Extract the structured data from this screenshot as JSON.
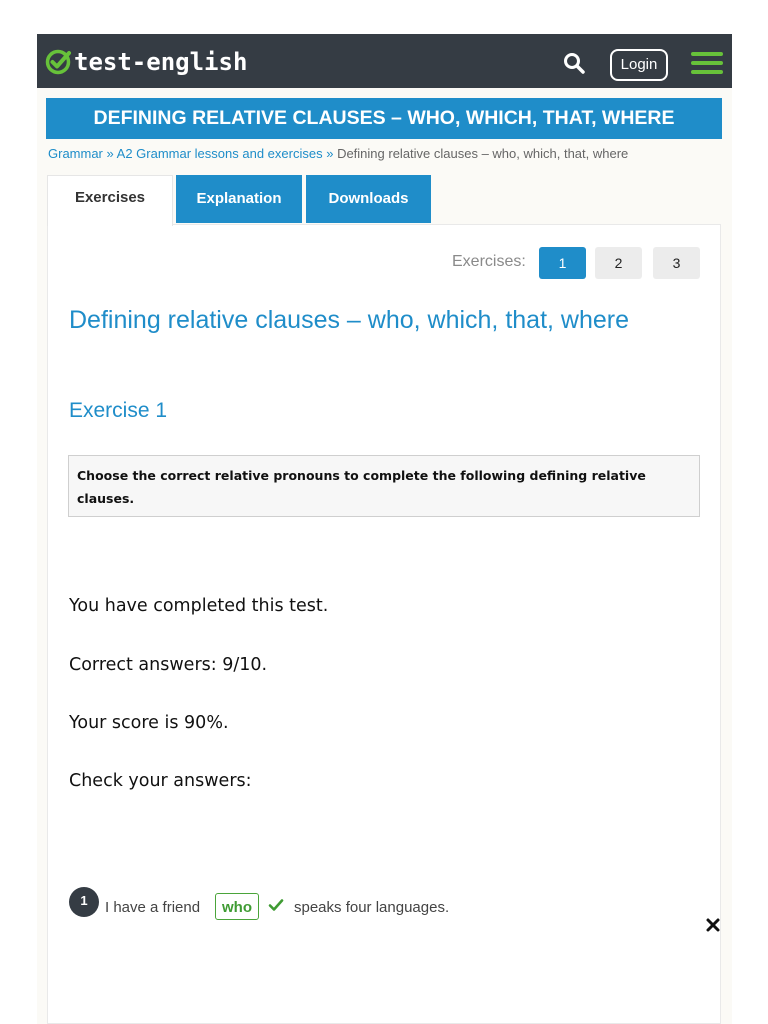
{
  "header": {
    "logo_text": "test-english",
    "login_label": "Login",
    "colors": {
      "bar": "#353c44",
      "accent_green": "#67c23a"
    }
  },
  "banner": {
    "title": "DEFINING RELATIVE CLAUSES – WHO, WHICH, THAT, WHERE",
    "color": "#1f8dc9"
  },
  "breadcrumb": {
    "items": [
      "Grammar",
      "A2 Grammar lessons and exercises"
    ],
    "separator": "»",
    "current": "Defining relative clauses – who, which, that, where"
  },
  "tabs": [
    {
      "label": "Exercises",
      "active": true
    },
    {
      "label": "Explanation",
      "active": false
    },
    {
      "label": "Downloads",
      "active": false
    }
  ],
  "exercise_nav": {
    "label": "Exercises:",
    "pages": [
      "1",
      "2",
      "3"
    ],
    "current": "1"
  },
  "content": {
    "title": "Defining relative clauses – who, which, that, where",
    "exercise_heading": "Exercise 1",
    "instruction": "Choose the correct relative pronouns to complete the following defining relative clauses."
  },
  "results": {
    "completed": "You have completed this test.",
    "correct": "Correct answers: 9/10.",
    "score": "Your score is 90%.",
    "check": "Check your answers:"
  },
  "questions": [
    {
      "number": "1",
      "before": "I have a friend",
      "answer": "who",
      "after": "speaks four languages.",
      "correct": true
    }
  ],
  "icons": {
    "logo": "check-circle-icon",
    "search": "search-icon",
    "menu": "hamburger-menu-icon",
    "correct": "checkmark-icon",
    "close": "close-icon"
  }
}
